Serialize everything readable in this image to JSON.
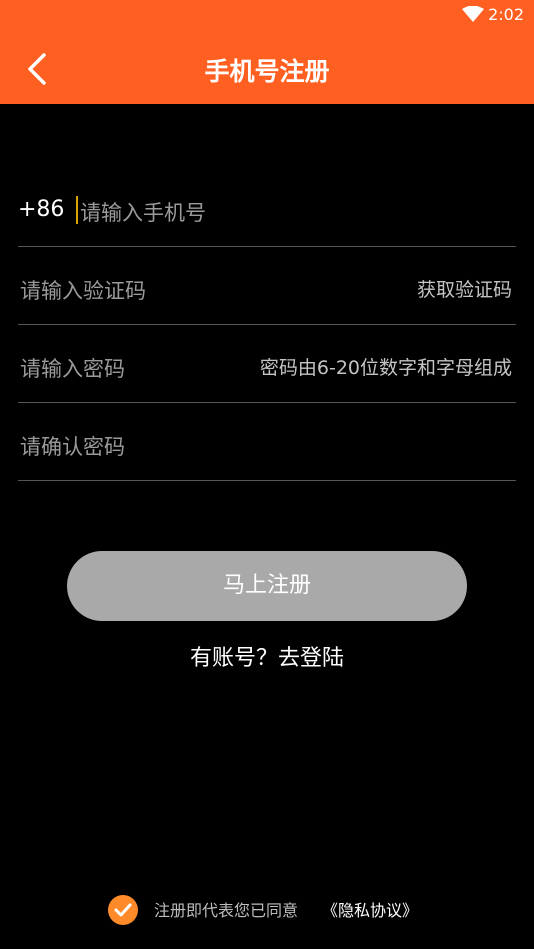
{
  "status_bar": {
    "time": "2:02",
    "wifi_icon": "wifi-icon"
  },
  "header": {
    "title": "手机号注册",
    "back_icon": "back-arrow-icon"
  },
  "form": {
    "phone": {
      "prefix": "+86",
      "placeholder": "请输入手机号"
    },
    "code": {
      "placeholder": "请输入验证码",
      "action": "获取验证码"
    },
    "password": {
      "placeholder": "请输入密码",
      "hint": "密码由6-20位数字和字母组成"
    },
    "confirm": {
      "placeholder": "请确认密码"
    }
  },
  "submit_label": "马上注册",
  "login_link": "有账号？去登陆",
  "agreement": {
    "text": "注册即代表您已同意",
    "link": "《隐私协议》",
    "checked": true
  },
  "colors": {
    "accent": "#FF6022",
    "button": "#A9A9A9",
    "check": "#FF8A2A"
  }
}
